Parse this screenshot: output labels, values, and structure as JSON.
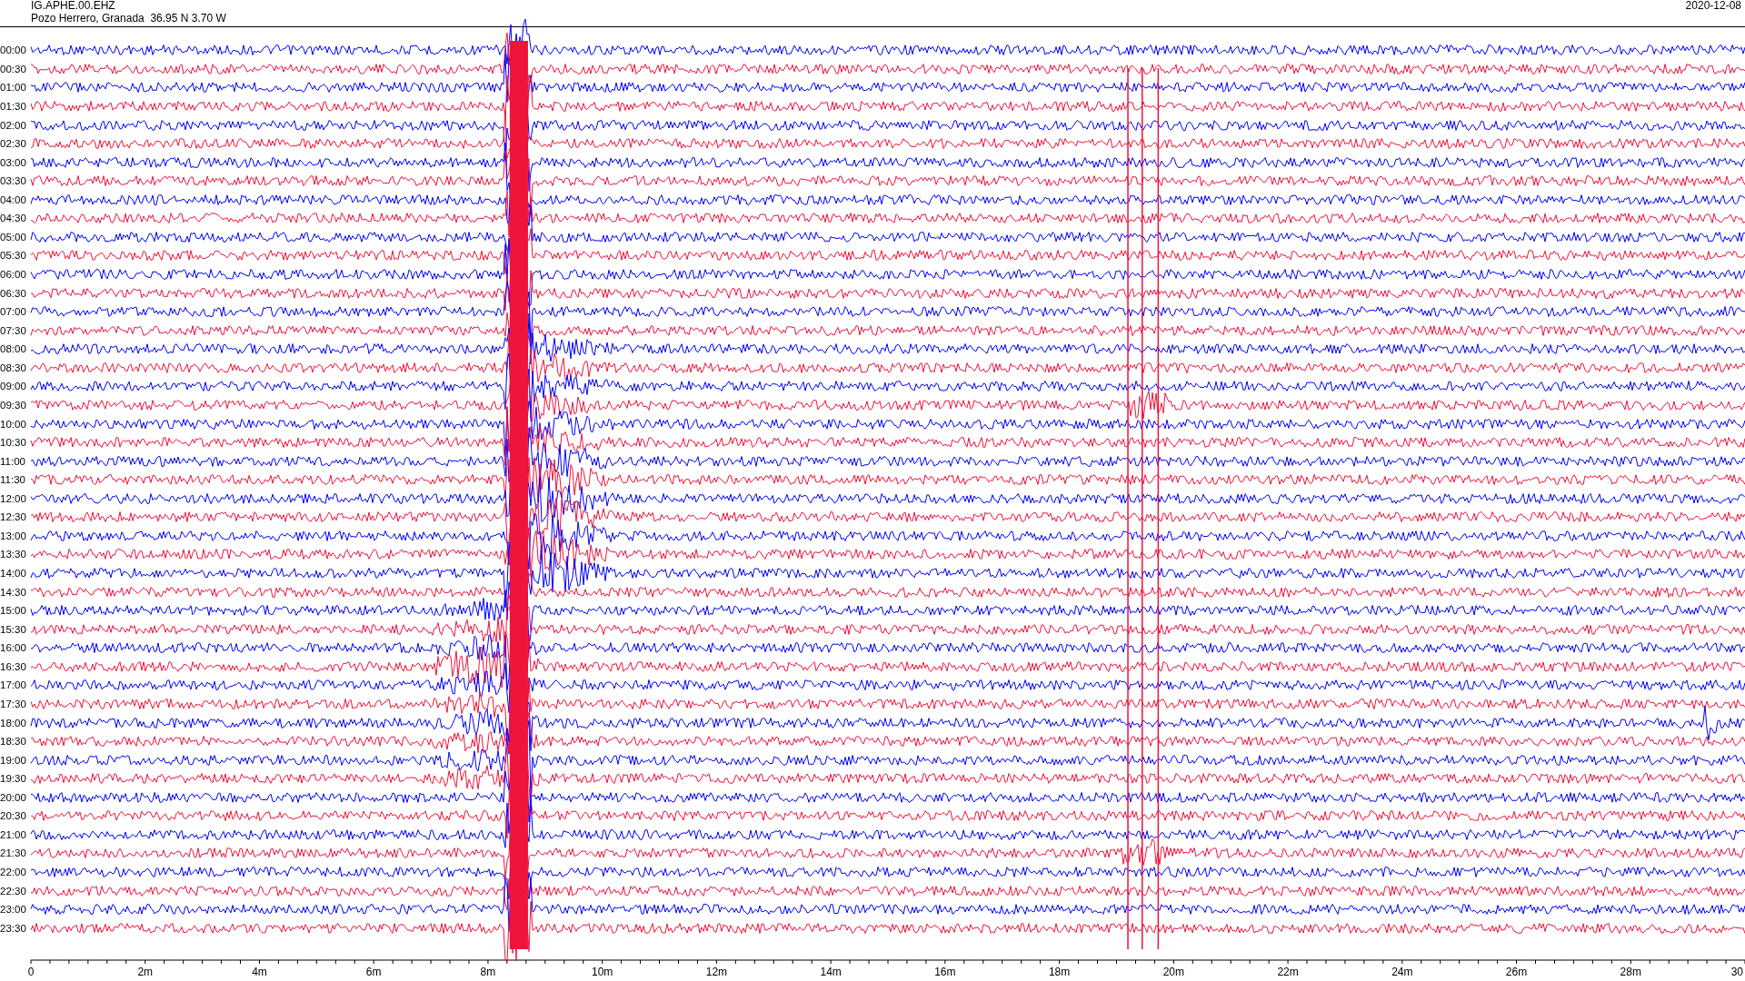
{
  "header": {
    "station": "IG.APHE.00.EHZ",
    "location": "Pozo Herrero, Granada  36.95 N 3.70 W",
    "date": "2020-12-08"
  },
  "rows": [
    {
      "time": "00:00",
      "color": "#0000ff"
    },
    {
      "time": "00:30",
      "color": "#f0133a"
    },
    {
      "time": "01:00",
      "color": "#0000ff"
    },
    {
      "time": "01:30",
      "color": "#f0133a"
    },
    {
      "time": "02:00",
      "color": "#0000ff"
    },
    {
      "time": "02:30",
      "color": "#f0133a"
    },
    {
      "time": "03:00",
      "color": "#0000ff"
    },
    {
      "time": "03:30",
      "color": "#f0133a"
    },
    {
      "time": "04:00",
      "color": "#0000ff"
    },
    {
      "time": "04:30",
      "color": "#f0133a"
    },
    {
      "time": "05:00",
      "color": "#0000ff"
    },
    {
      "time": "05:30",
      "color": "#f0133a"
    },
    {
      "time": "06:00",
      "color": "#0000ff"
    },
    {
      "time": "06:30",
      "color": "#f0133a"
    },
    {
      "time": "07:00",
      "color": "#0000ff"
    },
    {
      "time": "07:30",
      "color": "#f0133a"
    },
    {
      "time": "08:00",
      "color": "#0000ff"
    },
    {
      "time": "08:30",
      "color": "#f0133a"
    },
    {
      "time": "09:00",
      "color": "#0000ff"
    },
    {
      "time": "09:30",
      "color": "#f0133a"
    },
    {
      "time": "10:00",
      "color": "#0000ff"
    },
    {
      "time": "10:30",
      "color": "#f0133a"
    },
    {
      "time": "11:00",
      "color": "#0000ff"
    },
    {
      "time": "11:30",
      "color": "#f0133a"
    },
    {
      "time": "12:00",
      "color": "#0000ff"
    },
    {
      "time": "12:30",
      "color": "#f0133a"
    },
    {
      "time": "13:00",
      "color": "#0000ff"
    },
    {
      "time": "13:30",
      "color": "#f0133a"
    },
    {
      "time": "14:00",
      "color": "#0000ff"
    },
    {
      "time": "14:30",
      "color": "#f0133a"
    },
    {
      "time": "15:00",
      "color": "#0000ff"
    },
    {
      "time": "15:30",
      "color": "#f0133a"
    },
    {
      "time": "16:00",
      "color": "#0000ff"
    },
    {
      "time": "16:30",
      "color": "#f0133a"
    },
    {
      "time": "17:00",
      "color": "#0000ff"
    },
    {
      "time": "17:30",
      "color": "#f0133a"
    },
    {
      "time": "18:00",
      "color": "#0000ff"
    },
    {
      "time": "18:30",
      "color": "#f0133a"
    },
    {
      "time": "19:00",
      "color": "#0000ff"
    },
    {
      "time": "19:30",
      "color": "#f0133a"
    },
    {
      "time": "20:00",
      "color": "#0000ff"
    },
    {
      "time": "20:30",
      "color": "#f0133a"
    },
    {
      "time": "21:00",
      "color": "#0000ff"
    },
    {
      "time": "21:30",
      "color": "#f0133a"
    },
    {
      "time": "22:00",
      "color": "#0000ff"
    },
    {
      "time": "22:30",
      "color": "#f0133a"
    },
    {
      "time": "23:00",
      "color": "#0000ff"
    },
    {
      "time": "23:30",
      "color": "#f0133a"
    }
  ],
  "x_axis": {
    "labels": [
      "0",
      "2m",
      "4m",
      "6m",
      "8m",
      "10m",
      "12m",
      "14m",
      "16m",
      "18m",
      "20m",
      "22m",
      "24m",
      "26m",
      "28m",
      "30"
    ]
  }
}
